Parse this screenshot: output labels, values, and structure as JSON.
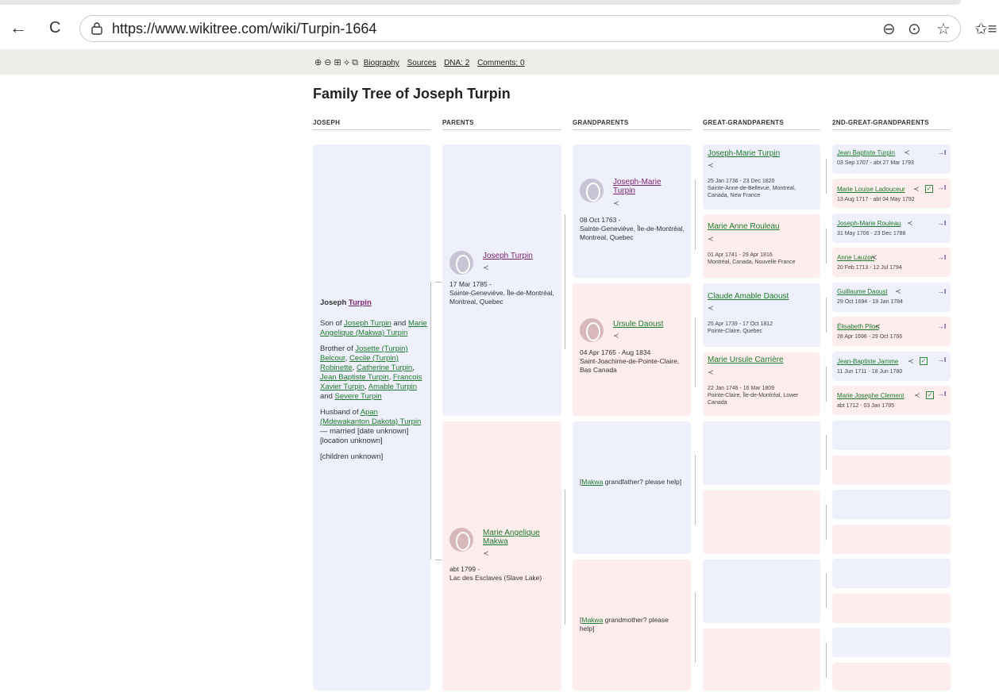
{
  "browser": {
    "url": "https://www.wikitree.com/wiki/Turpin-1664",
    "back_icon": "←",
    "reload_icon": "C",
    "zoom_icon": "⊖",
    "more_icon": "⊙",
    "favorite_icon": "☆",
    "favorites_bar_icon": "✩≡"
  },
  "toolbar": {
    "icons": "⊕ ⊖ ⊞ ⟡ ⧉",
    "biography": "Biography",
    "sources": "Sources",
    "dna": "DNA: 2",
    "comments": "Comments: 0"
  },
  "title": "Family Tree of Joseph Turpin",
  "columns": [
    "JOSEPH",
    "PARENTS",
    "GRANDPARENTS",
    "GREAT-GRANDPARENTS",
    "2ND-GREAT-GRANDPARENTS"
  ],
  "joseph": {
    "first": "Joseph ",
    "last": "Turpin",
    "son_of": "Son of ",
    "father": "Joseph Turpin",
    "and": " and ",
    "mother": "Marie Angelique (Makwa) Turpin",
    "brother_of": "Brother of ",
    "sib1": "Josette (Turpin) Belcour",
    "sib2": "Cecile (Turpin) Robinette",
    "sib3": "Catherine Turpin",
    "sib4": "Jean Baptiste Turpin",
    "sib5": "Francois Xavier Turpin",
    "sib6": "Amable Turpin",
    "sib7": "Severe Turpin",
    "husband_of": "Husband of ",
    "spouse": "Apan (Mdewakanton Dakota) Turpin",
    "married": " — married [date unknown] [location unknown]",
    "children": "[children unknown]"
  },
  "parents": {
    "father": {
      "name": "Joseph Turpin",
      "date": "17 Mar 1785 -",
      "place": "Sainte-Geneviève, Île-de-Montréal, Montreal, Quebec"
    },
    "mother": {
      "name": "Marie Angelique Makwa",
      "date": "abt 1799 -",
      "place": "Lac des Esclaves (Slave Lake)"
    }
  },
  "grandparents": {
    "g1": {
      "name": "Joseph-Marie Turpin",
      "date": "08 Oct 1763 -",
      "place": "Sainte-Geneviève, Île-de-Montréal, Montreal, Quebec"
    },
    "g2": {
      "name": "Ursule Daoust",
      "date": "04 Apr 1765 - Aug 1834",
      "place": "Saint-Joachime-de-Pointe-Claire, Bas Canada"
    },
    "g3": {
      "link": "Makwa",
      "text": " grandfather? please help]"
    },
    "g4": {
      "link": "Makwa",
      "text": " grandmother? please help]"
    }
  },
  "great_grandparents": [
    {
      "name": "Joseph-Marie Turpin",
      "dates": "25 Jan 1736 - 23 Dec 1820",
      "place": "Sainte-Anne-de-Bellevue, Montreal, Canada, New France"
    },
    {
      "name": "Marie Anne Rouleau",
      "dates": "01 Apr 1741 - 29 Apr 1816",
      "place": "Montréal, Canada, Nouvelle France"
    },
    {
      "name": "Claude Amable Daoust",
      "dates": "25 Apr 1739 - 17 Oct 1812",
      "place": "Pointe-Claire, Quebec"
    },
    {
      "name": "Marie Ursule Carrière",
      "dates": "22 Jan 1746 - 16 Mar 1809",
      "place": "Pointe-Claire, Île-de-Montréal, Lower Canada"
    }
  ],
  "ggg": [
    {
      "name": "Jean Baptiste Turpin",
      "dates": "03 Sep 1707 - abt 27 Mar 1793"
    },
    {
      "name": "Marie Louise Ladouceur",
      "dates": "13 Aug 1717 - abt 04 May 1792"
    },
    {
      "name": "Joseph-Marie Rouleau",
      "dates": "31 May 1706 - 23 Dec 1788"
    },
    {
      "name": "Anne Lauzon",
      "dates": "20 Feb 1713 - 12 Jul 1794"
    },
    {
      "name": "Guillaume Daoust",
      "dates": "29 Oct 1694 - 19 Jan 1784"
    },
    {
      "name": "Élisabeth Pilon",
      "dates": "28 Apr 1696 - 29 Oct 1766"
    },
    {
      "name": "Jean-Baptiste Jamme",
      "dates": "11 Jun 1711 - 18 Jun 1780"
    },
    {
      "name": "Marie Josephe Clement",
      "dates": "abt 1712 - 03 Jan 1785"
    }
  ],
  "share_icon": "≺",
  "arrow_icon": "→I",
  "check_icon": "✓",
  "open_bracket": "["
}
